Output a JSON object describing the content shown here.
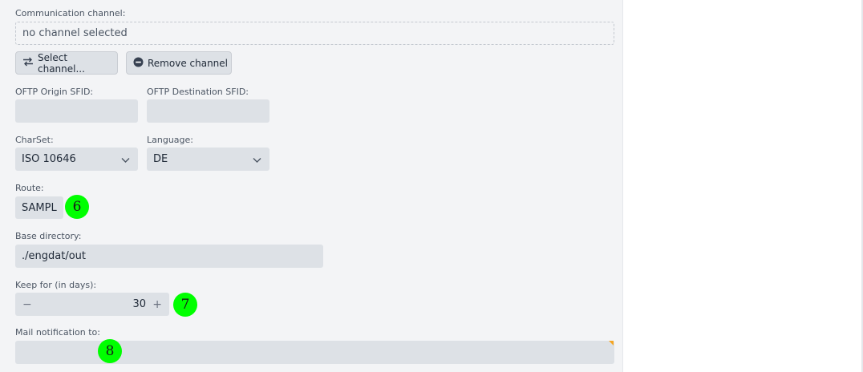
{
  "channel": {
    "label": "Communication channel:",
    "value": "no channel selected",
    "select_button": "Select channel...",
    "remove_button": "Remove channel"
  },
  "oftp": {
    "origin_label": "OFTP Origin SFID:",
    "origin_value": "",
    "destination_label": "OFTP Destination SFID:",
    "destination_value": ""
  },
  "charset": {
    "label": "CharSet:",
    "value": "ISO 10646"
  },
  "language": {
    "label": "Language:",
    "value": "DE"
  },
  "route": {
    "label": "Route:",
    "value": "SAMPL"
  },
  "base_directory": {
    "label": "Base directory:",
    "value": "./engdat/out"
  },
  "keep_for": {
    "label": "Keep for (in days):",
    "value": "30",
    "minus": "−",
    "plus": "+"
  },
  "mail": {
    "label": "Mail notification to:",
    "value": ""
  },
  "markers": [
    "6",
    "7",
    "8"
  ]
}
